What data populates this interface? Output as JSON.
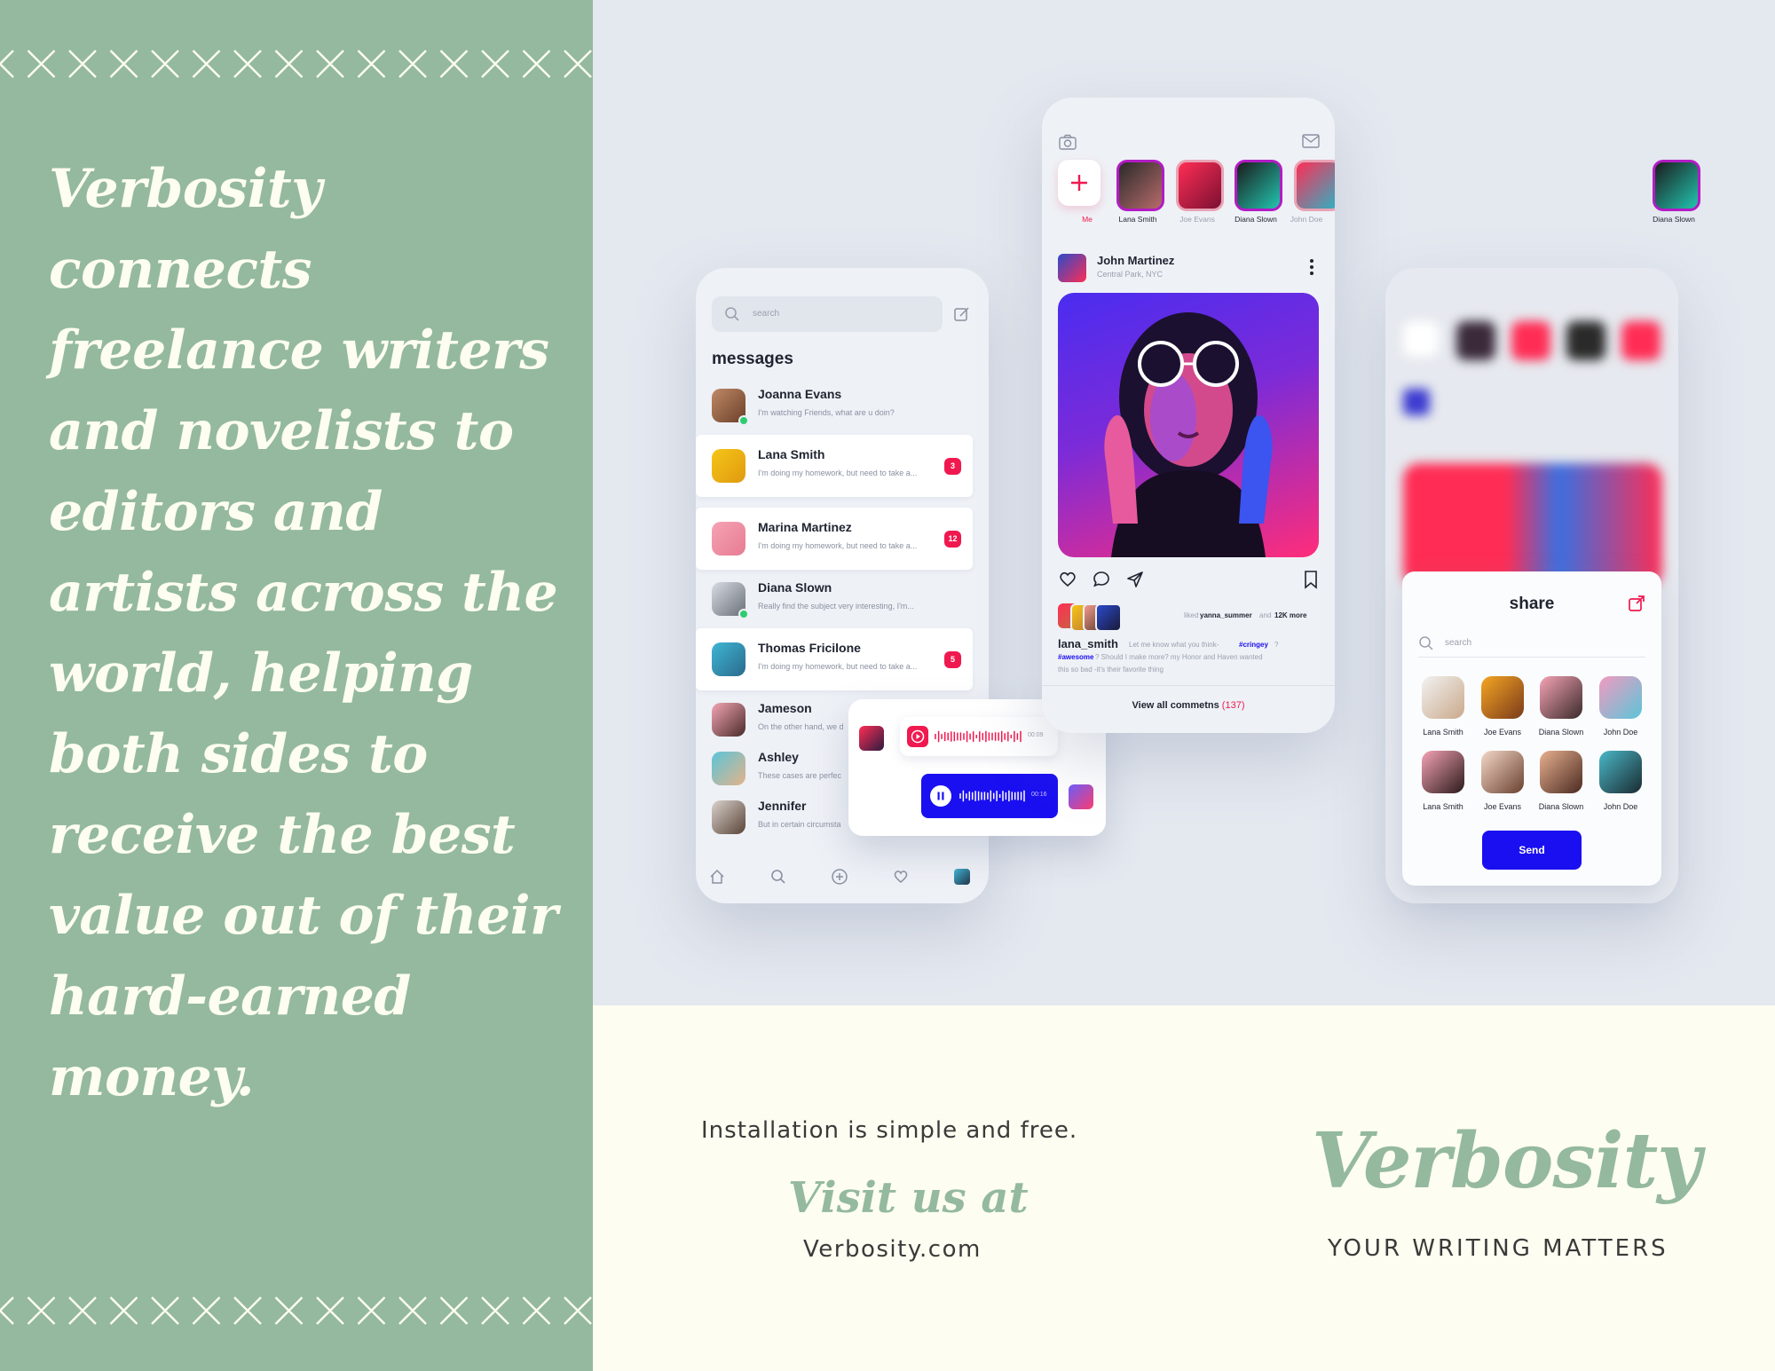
{
  "tagline": "Verbosity connects freelance writers and novelists to editors and artists across the world, helping both sides to receive the best value out of their hard-earned money.",
  "colors": {
    "accent_green": "#94b99e",
    "cream": "#fdfdf1",
    "mockup_bg": "#e4e8ef",
    "badge_red": "#f0194f",
    "send_blue": "#1a0ff0"
  },
  "messages_app": {
    "search_placeholder": "search",
    "title": "messages",
    "conversations": [
      {
        "name": "Joanna Evans",
        "preview": "I'm watching Friends, what are u doin?",
        "badge": "",
        "online": true
      },
      {
        "name": "Lana Smith",
        "preview": "I'm doing my homework, but need to take a...",
        "badge": "3",
        "online": false
      },
      {
        "name": "Marina Martinez",
        "preview": "I'm doing my homework, but need to take a...",
        "badge": "12",
        "online": false
      },
      {
        "name": "Diana Slown",
        "preview": "Really find the subject very interesting, I'm...",
        "badge": "",
        "online": true
      },
      {
        "name": "Thomas Fricilone",
        "preview": "I'm doing my homework, but need to take a...",
        "badge": "5",
        "online": false
      },
      {
        "name": "Jameson",
        "preview": "On the other hand, we d",
        "badge": "",
        "online": false
      },
      {
        "name": "Ashley",
        "preview": "These cases are perfec",
        "badge": "",
        "online": false
      },
      {
        "name": "Jennifer",
        "preview": "But in certain circumsta",
        "badge": "",
        "online": false
      }
    ],
    "nav_icons": [
      "home-icon",
      "search-icon",
      "add-icon",
      "heart-icon",
      "profile-icon"
    ],
    "voice": {
      "time_received": "00:09",
      "time_sent": "00:16"
    }
  },
  "feed_app": {
    "stories": [
      {
        "label": "Me"
      },
      {
        "label": "Lana Smith"
      },
      {
        "label": "Joe Evans"
      },
      {
        "label": "Diana Slown"
      },
      {
        "label": "John Doe"
      },
      {
        "label": "Diana Slown"
      }
    ],
    "post": {
      "author": "John Martinez",
      "location": "Central Park, NYC",
      "liked_prefix": "liked",
      "liked_user": "yanna_summer",
      "liked_and": "and",
      "liked_more": "12K more",
      "caption_user": "lana_smith",
      "caption_text": "Let me know what you think-",
      "caption_tag1": "#cringey",
      "caption_tail1": "?",
      "caption_tag2": "#awesome",
      "caption_text2": "? Should I make more? my Honor and Haven wanted",
      "caption_text3": "this so bad -it's their favorite thing",
      "comments_label": "View all commetns",
      "comments_count": "(137)"
    }
  },
  "share_app": {
    "title": "share",
    "search_placeholder": "search",
    "contacts": [
      {
        "name": "Lana Smith"
      },
      {
        "name": "Joe Evans"
      },
      {
        "name": "Diana Slown"
      },
      {
        "name": "John Doe"
      },
      {
        "name": "Lana Smith"
      },
      {
        "name": "Joe Evans"
      },
      {
        "name": "Diana Slown"
      },
      {
        "name": "John Doe"
      }
    ],
    "send_label": "Send"
  },
  "footer": {
    "install": "Installation is simple and free.",
    "visit": "Visit us at",
    "site": "Verbosity.com",
    "brand": "Verbosity",
    "motto": "YOUR WRITING MATTERS"
  }
}
